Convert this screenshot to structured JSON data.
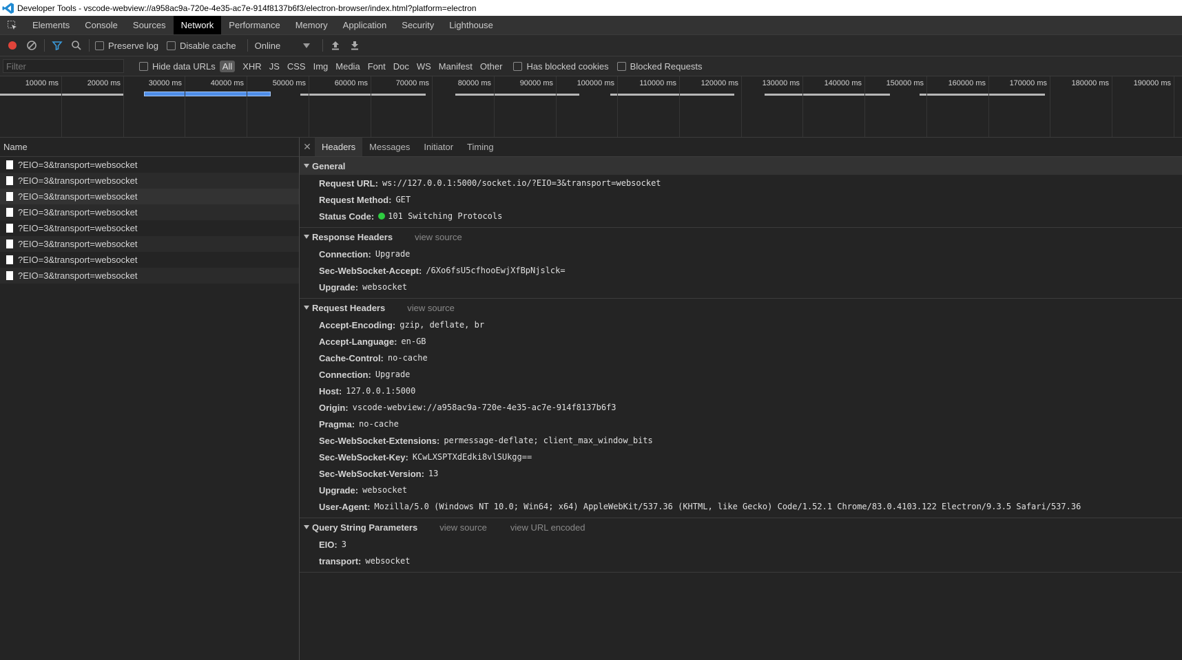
{
  "window": {
    "title": "Developer Tools - vscode-webview://a958ac9a-720e-4e35-ac7e-914f8137b6f3/electron-browser/index.html?platform=electron"
  },
  "tabs": [
    {
      "label": "Elements"
    },
    {
      "label": "Console"
    },
    {
      "label": "Sources"
    },
    {
      "label": "Network",
      "active": true
    },
    {
      "label": "Performance"
    },
    {
      "label": "Memory"
    },
    {
      "label": "Application"
    },
    {
      "label": "Security"
    },
    {
      "label": "Lighthouse"
    }
  ],
  "toolbar": {
    "preserve_log": "Preserve log",
    "disable_cache": "Disable cache",
    "throttle": "Online"
  },
  "filterbar": {
    "placeholder": "Filter",
    "hide_data_urls": "Hide data URLs",
    "types": [
      "All",
      "XHR",
      "JS",
      "CSS",
      "Img",
      "Media",
      "Font",
      "Doc",
      "WS",
      "Manifest",
      "Other"
    ],
    "has_blocked_cookies": "Has blocked cookies",
    "blocked_requests": "Blocked Requests"
  },
  "overview": {
    "ticks": [
      "10000 ms",
      "20000 ms",
      "30000 ms",
      "40000 ms",
      "50000 ms",
      "60000 ms",
      "70000 ms",
      "80000 ms",
      "90000 ms",
      "100000 ms",
      "110000 ms",
      "120000 ms",
      "130000 ms",
      "140000 ms",
      "150000 ms",
      "160000 ms",
      "170000 ms",
      "180000 ms",
      "190000 ms"
    ]
  },
  "list": {
    "header": "Name",
    "rows": [
      "?EIO=3&transport=websocket",
      "?EIO=3&transport=websocket",
      "?EIO=3&transport=websocket",
      "?EIO=3&transport=websocket",
      "?EIO=3&transport=websocket",
      "?EIO=3&transport=websocket",
      "?EIO=3&transport=websocket",
      "?EIO=3&transport=websocket"
    ]
  },
  "detail_tabs": [
    {
      "label": "Headers",
      "active": true
    },
    {
      "label": "Messages"
    },
    {
      "label": "Initiator"
    },
    {
      "label": "Timing"
    }
  ],
  "general": {
    "title": "General",
    "items": [
      {
        "k": "Request URL:",
        "v": "ws://127.0.0.1:5000/socket.io/?EIO=3&transport=websocket"
      },
      {
        "k": "Request Method:",
        "v": "GET"
      },
      {
        "k": "Status Code:",
        "v": "101 Switching Protocols",
        "status": true
      }
    ]
  },
  "response_headers": {
    "title": "Response Headers",
    "link": "view source",
    "items": [
      {
        "k": "Connection:",
        "v": "Upgrade"
      },
      {
        "k": "Sec-WebSocket-Accept:",
        "v": "/6Xo6fsU5cfhooEwjXfBpNjslck="
      },
      {
        "k": "Upgrade:",
        "v": "websocket"
      }
    ]
  },
  "request_headers": {
    "title": "Request Headers",
    "link": "view source",
    "items": [
      {
        "k": "Accept-Encoding:",
        "v": "gzip, deflate, br"
      },
      {
        "k": "Accept-Language:",
        "v": "en-GB"
      },
      {
        "k": "Cache-Control:",
        "v": "no-cache"
      },
      {
        "k": "Connection:",
        "v": "Upgrade"
      },
      {
        "k": "Host:",
        "v": "127.0.0.1:5000"
      },
      {
        "k": "Origin:",
        "v": "vscode-webview://a958ac9a-720e-4e35-ac7e-914f8137b6f3"
      },
      {
        "k": "Pragma:",
        "v": "no-cache"
      },
      {
        "k": "Sec-WebSocket-Extensions:",
        "v": "permessage-deflate; client_max_window_bits"
      },
      {
        "k": "Sec-WebSocket-Key:",
        "v": "KCwLXSPTXdEdki8vlSUkgg=="
      },
      {
        "k": "Sec-WebSocket-Version:",
        "v": "13"
      },
      {
        "k": "Upgrade:",
        "v": "websocket"
      },
      {
        "k": "User-Agent:",
        "v": "Mozilla/5.0 (Windows NT 10.0; Win64; x64) AppleWebKit/537.36 (KHTML, like Gecko) Code/1.52.1 Chrome/83.0.4103.122 Electron/9.3.5 Safari/537.36"
      }
    ]
  },
  "query_params": {
    "title": "Query String Parameters",
    "link": "view source",
    "link2": "view URL encoded",
    "items": [
      {
        "k": "EIO:",
        "v": "3"
      },
      {
        "k": "transport:",
        "v": "websocket"
      }
    ]
  },
  "colors": {
    "record": "#e0443a",
    "status_ok": "#2ecc40",
    "selection": "#4f8ee8",
    "filter_icon": "#3a9bdc"
  },
  "icons": {
    "inspect": "inspect-icon",
    "record": "record-icon",
    "clear": "clear-icon",
    "filter": "filter-icon",
    "search": "search-icon",
    "import": "upload-icon",
    "export": "download-icon"
  }
}
